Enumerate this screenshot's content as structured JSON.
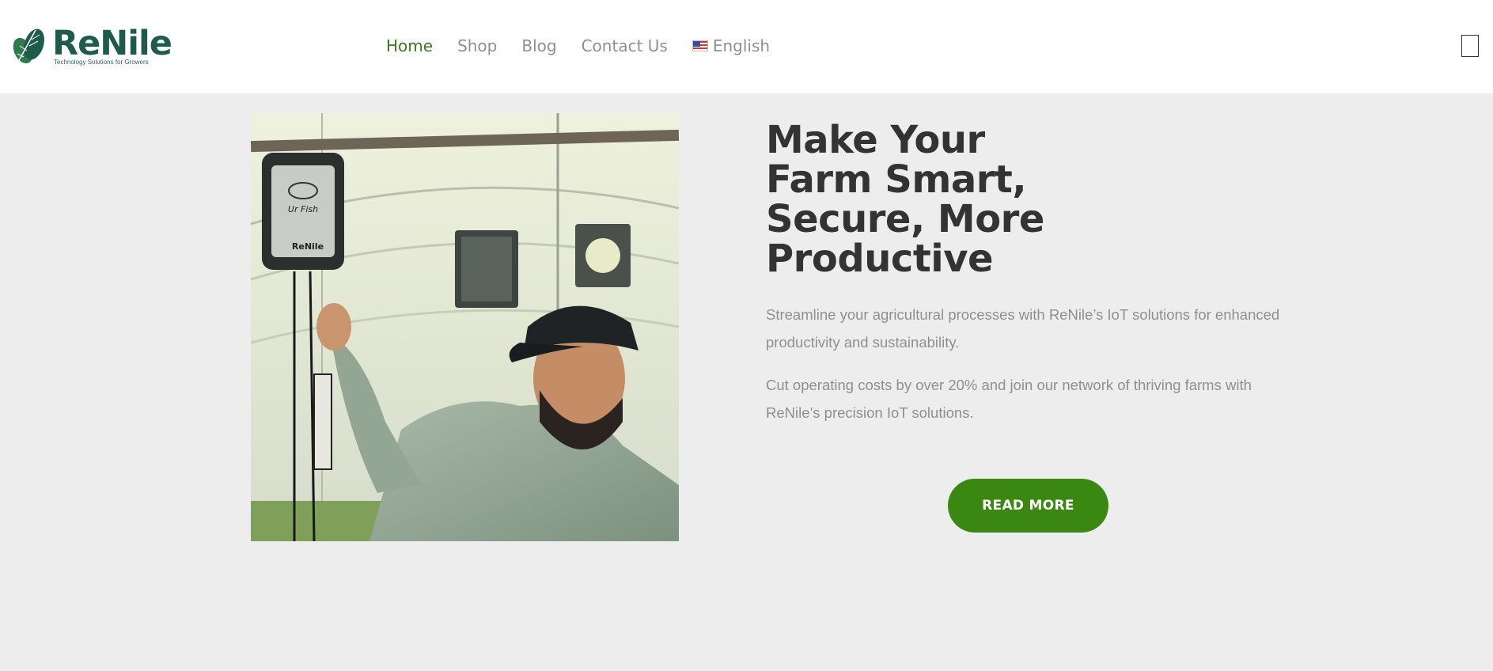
{
  "brand": {
    "name": "ReNile",
    "tagline": "Technology Solutions for Growers"
  },
  "nav": {
    "items": [
      {
        "label": "Home",
        "active": true
      },
      {
        "label": "Shop",
        "active": false
      },
      {
        "label": "Blog",
        "active": false
      },
      {
        "label": "Contact Us",
        "active": false
      }
    ],
    "language": {
      "label": "English",
      "icon": "us-flag-icon"
    }
  },
  "menu_toggle": {
    "icon": "hamburger-menu-icon"
  },
  "hero": {
    "title": "Make Your Farm Smart, Secure, More Productive",
    "paragraph1": "Streamline your agricultural processes with ReNile’s IoT solutions for enhanced productivity and sustainability.",
    "paragraph2": "Cut operating costs by over 20% and join our network of thriving farms with ReNile’s precision IoT solutions.",
    "cta_label": "READ MORE",
    "device_label": "Ur Fish",
    "device_brand": "ReNile"
  },
  "colors": {
    "brand_dark": "#1f5b4c",
    "accent_green": "#3a8712",
    "nav_active": "#3a7a1c",
    "background": "#ededed",
    "text_muted": "#8f8f8f",
    "heading": "#333333"
  }
}
